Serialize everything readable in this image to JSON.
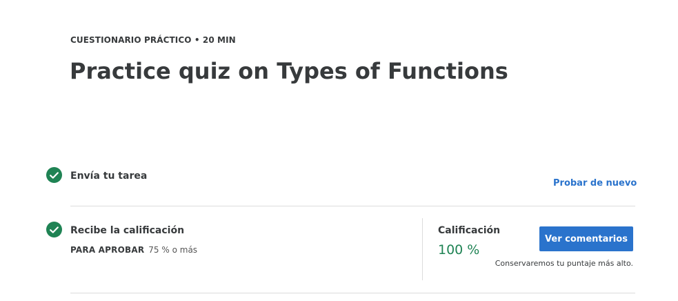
{
  "header": {
    "eyebrow": "CUESTIONARIO PRÁCTICO • 20 MIN",
    "title": "Practice quiz on Types of Functions"
  },
  "steps": {
    "submit": {
      "label": "Envía tu tarea",
      "action_label": "Probar de nuevo",
      "status_icon": "check-circle-icon"
    },
    "grade": {
      "label": "Recibe la calificación",
      "status_icon": "check-circle-icon",
      "pass_key": "PARA APROBAR",
      "pass_value": "75 % o más",
      "grade_label": "Calificación",
      "grade_value": "100 %",
      "button_label": "Ver comentarios",
      "note": "Conservaremos tu puntaje más alto."
    }
  },
  "colors": {
    "success": "#1f8354",
    "accent": "#2a73cc",
    "text": "#373a3c"
  }
}
